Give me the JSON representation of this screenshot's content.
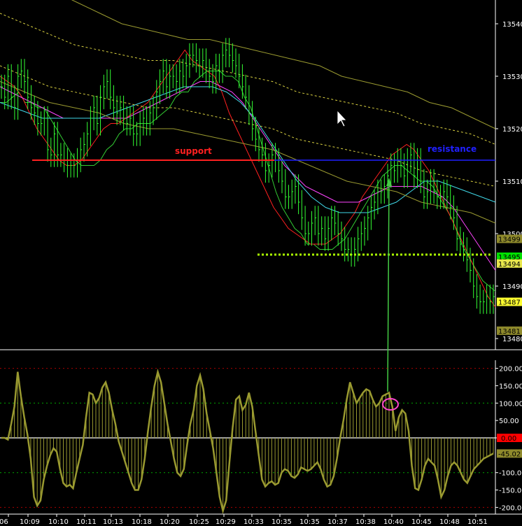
{
  "chart_data": [
    {
      "type": "line",
      "panel": "price",
      "instrument_axis_labels": [
        "13540",
        "13530",
        "13520",
        "13510",
        "13500",
        "13490",
        "13480"
      ],
      "y_ticks": [
        13540,
        13530,
        13520,
        13510,
        13500,
        13490,
        13480
      ],
      "ylim": [
        13477,
        13546
      ],
      "price_tags": [
        {
          "text": "13499",
          "value": 13499,
          "bg": "#8f8a2c",
          "fg": "#000000"
        },
        {
          "text": "13495",
          "value": 13495.6,
          "bg": "#00e000",
          "fg": "#000000"
        },
        {
          "text": "13494",
          "value": 13494.3,
          "bg": "#e8e84c",
          "fg": "#000000"
        },
        {
          "text": "13487",
          "value": 13487,
          "bg": "#ffff30",
          "fg": "#000000"
        },
        {
          "text": "13481",
          "value": 13481.5,
          "bg": "#8f8a2c",
          "fg": "#000000"
        }
      ],
      "bar_count": 160,
      "price_bars_close": [
        13528,
        13526,
        13530,
        13526,
        13524,
        13530,
        13531,
        13529,
        13526,
        13524,
        13523,
        13521,
        13521,
        13522,
        13516,
        13515,
        13519,
        13515,
        13515,
        13514,
        13513,
        13513,
        13513,
        13514,
        13516,
        13517,
        13519,
        13522,
        13524,
        13521,
        13526,
        13528,
        13529,
        13526,
        13524,
        13523,
        13524,
        13522,
        13521,
        13522,
        13519,
        13519,
        13521,
        13522,
        13521,
        13523,
        13524,
        13527,
        13529,
        13531,
        13528,
        13530,
        13530,
        13529,
        13531,
        13530,
        13532,
        13534,
        13534,
        13533,
        13532,
        13533,
        13531,
        13530,
        13529,
        13532,
        13531,
        13534,
        13535,
        13534,
        13533,
        13532,
        13530,
        13528,
        13526,
        13523,
        13520,
        13518,
        13516,
        13515,
        13512,
        13513,
        13515,
        13514,
        13512,
        13510,
        13507,
        13507,
        13508,
        13509,
        13506,
        13503,
        13500,
        13500,
        13502,
        13503,
        13500,
        13501,
        13499,
        13501,
        13503,
        13502,
        13500,
        13499,
        13497,
        13497,
        13496,
        13497,
        13499,
        13500,
        13501,
        13503,
        13505,
        13506,
        13508,
        13508,
        13509,
        13511,
        13513,
        13512,
        13514,
        13513,
        13511,
        13514,
        13515,
        13511,
        13514,
        13510,
        13507,
        13508,
        13510,
        13508,
        13507,
        13507,
        13508,
        13507,
        13505,
        13503,
        13499,
        13498,
        13497,
        13495,
        13493,
        13490,
        13488,
        13487,
        13487,
        13488,
        13487,
        13488
      ],
      "lines": [
        {
          "name": "green",
          "color": "#33cc33",
          "values": [
            13525,
            13525,
            13526,
            13527,
            13525,
            13525,
            13524,
            13524,
            13522,
            13520,
            13518,
            13516,
            13514,
            13513,
            13513,
            13513,
            13514,
            13516,
            13517,
            13519,
            13520,
            13520,
            13521,
            13521,
            13521,
            13522,
            13523,
            13524,
            13526,
            13527,
            13527,
            13529,
            13530,
            13531,
            13531,
            13531,
            13530,
            13530,
            13529,
            13526,
            13524,
            13520,
            13516,
            13512,
            13508,
            13505,
            13503,
            13501,
            13500,
            13498,
            13498,
            13497,
            13497,
            13497,
            13498,
            13499,
            13501,
            13503,
            13505,
            13507,
            13509,
            13511,
            13512,
            13513,
            13513,
            13512,
            13511,
            13510,
            13510,
            13509,
            13507,
            13505,
            13503,
            13500,
            13497,
            13495,
            13493,
            13491,
            13490,
            13489
          ]
        },
        {
          "name": "red",
          "color": "#ff2020",
          "values": [
            13530,
            13529,
            13528,
            13526,
            13523,
            13520,
            13518,
            13516,
            13514,
            13513,
            13513,
            13514,
            13516,
            13518,
            13520,
            13521,
            13521,
            13522,
            13523,
            13524,
            13525,
            13527,
            13529,
            13531,
            13533,
            13535,
            13533,
            13532,
            13531,
            13530,
            13527,
            13523,
            13520,
            13517,
            13514,
            13511,
            13508,
            13505,
            13503,
            13501,
            13500,
            13499,
            13498,
            13498,
            13498,
            13499,
            13500,
            13502,
            13504,
            13507,
            13509,
            13511,
            13513,
            13515,
            13516,
            13517,
            13516,
            13514,
            13512,
            13509,
            13506,
            13503,
            13500,
            13497,
            13494,
            13491,
            13488,
            13486
          ]
        },
        {
          "name": "magenta",
          "color": "#ff44ff",
          "values": [
            13528,
            13527,
            13526,
            13525,
            13524,
            13523,
            13522,
            13522,
            13522,
            13522,
            13522,
            13522,
            13522,
            13523,
            13524,
            13525,
            13526,
            13527,
            13528,
            13529,
            13529,
            13528,
            13527,
            13525,
            13522,
            13519,
            13516,
            13513,
            13511,
            13509,
            13508,
            13507,
            13506,
            13506,
            13506,
            13507,
            13508,
            13509,
            13509,
            13509,
            13509,
            13508,
            13507,
            13505,
            13502,
            13499,
            13496,
            13493
          ]
        },
        {
          "name": "cyan",
          "color": "#40d8e8",
          "values": [
            13525,
            13524,
            13523,
            13522,
            13522,
            13522,
            13522,
            13522,
            13523,
            13524,
            13525,
            13526,
            13527,
            13528,
            13528,
            13528,
            13527,
            13525,
            13522,
            13518,
            13514,
            13510,
            13507,
            13505,
            13504,
            13504,
            13504,
            13505,
            13506,
            13508,
            13510,
            13510,
            13509,
            13508,
            13507,
            13506
          ]
        },
        {
          "name": "olive-upper",
          "color": "#9a9a30",
          "values": [
            13546,
            13544,
            13542,
            13540,
            13539,
            13538,
            13537,
            13537,
            13536,
            13535,
            13534,
            13533,
            13532,
            13530,
            13529,
            13528,
            13527,
            13525,
            13524,
            13522,
            13520
          ]
        },
        {
          "name": "olive-middle",
          "color": "#9a9a30",
          "values": [
            13529,
            13527,
            13525,
            13524,
            13523,
            13521,
            13520,
            13520,
            13519,
            13518,
            13517,
            13516,
            13514,
            13512,
            13510,
            13509,
            13508,
            13506,
            13505,
            13504,
            13502
          ]
        },
        {
          "name": "yellow-dotted-upper",
          "color": "#d8d040",
          "values": [
            13542,
            13540,
            13538,
            13536,
            13535,
            13534,
            13533,
            13533,
            13532,
            13531,
            13530,
            13529,
            13527,
            13526,
            13525,
            13524,
            13523,
            13521,
            13520,
            13519,
            13517
          ]
        },
        {
          "name": "yellow-dotted-lower",
          "color": "#d8d040",
          "values": [
            13532,
            13530,
            13528,
            13527,
            13526,
            13525,
            13524,
            13524,
            13523,
            13522,
            13521,
            13520,
            13518,
            13517,
            13516,
            13515,
            13514,
            13512,
            13511,
            13510,
            13509
          ]
        }
      ],
      "annotations": [
        {
          "text": "support",
          "color": "#ff2020",
          "level": 13514
        },
        {
          "text": "resistance",
          "color": "#2020ff",
          "level": 13514
        },
        {
          "text": "",
          "color": "#aaff00",
          "level": 13496,
          "style": "dotted"
        }
      ],
      "x_tick_labels": [
        "06",
        "10:09",
        "10:10",
        "10:11",
        "10:13",
        "10:18",
        "10:20",
        "10:25",
        "10:29",
        "10:33",
        "10:35",
        "10:35",
        "10:37",
        "10:38",
        "10:40",
        "10:45",
        "10:48",
        "10:51"
      ]
    },
    {
      "type": "bar",
      "panel": "oscillator",
      "y_ticks": [
        200,
        150,
        100,
        50,
        0,
        -100,
        -150,
        -200
      ],
      "y_tick_labels": [
        "200.00",
        "150.00",
        "100.00",
        "50.00",
        "0.00",
        "-100.00",
        "-150.00",
        "-200.00"
      ],
      "ylim": [
        -210,
        210
      ],
      "value_tag": {
        "text": "-45.02",
        "value": -45.02,
        "bg": "#8f8a2c",
        "fg": "#000000"
      },
      "zero_tag": {
        "text": "0.00",
        "bg": "#ff0000",
        "fg": "#000000"
      },
      "reference_lines": [
        200,
        100,
        -100,
        -200
      ],
      "values": [
        0,
        0,
        -5,
        40,
        90,
        190,
        120,
        60,
        10,
        -60,
        -170,
        -195,
        -180,
        -120,
        -80,
        -50,
        -30,
        -40,
        -90,
        -130,
        -140,
        -135,
        -145,
        -100,
        -60,
        -20,
        60,
        130,
        125,
        100,
        115,
        145,
        160,
        130,
        80,
        40,
        -10,
        -40,
        -70,
        -100,
        -130,
        -150,
        -150,
        -120,
        -60,
        20,
        90,
        150,
        190,
        160,
        100,
        40,
        -10,
        -60,
        -100,
        -110,
        -90,
        -20,
        40,
        80,
        150,
        180,
        140,
        70,
        20,
        -30,
        -100,
        -170,
        -210,
        -180,
        -70,
        30,
        110,
        120,
        80,
        95,
        130,
        90,
        20,
        -50,
        -120,
        -140,
        -130,
        -125,
        -135,
        -130,
        -100,
        -90,
        -95,
        -110,
        -115,
        -105,
        -85,
        -90,
        -95,
        -90,
        -80,
        -70,
        -90,
        -120,
        -140,
        -135,
        -110,
        -60,
        0,
        50,
        110,
        160,
        130,
        100,
        115,
        130,
        140,
        135,
        110,
        90,
        100,
        120,
        125,
        130,
        90,
        20,
        60,
        80,
        70,
        20,
        -80,
        -145,
        -150,
        -120,
        -80,
        -60,
        -70,
        -80,
        -120,
        -170,
        -150,
        -110,
        -80,
        -70,
        -80,
        -100,
        -120,
        -130,
        -110,
        -90,
        -80,
        -70,
        -60,
        -55,
        -50,
        -45
      ]
    }
  ]
}
